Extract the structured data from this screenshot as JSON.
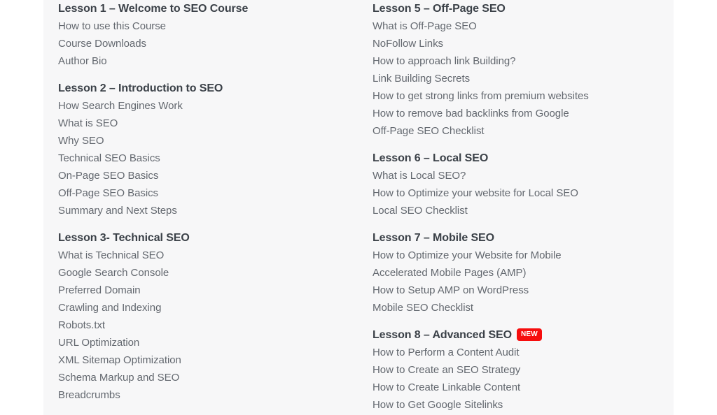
{
  "page": {
    "background_color": "#ffffff",
    "panel_background_color": "#f7f7f8",
    "heading_color": "#3b4148",
    "topic_color": "#63686f",
    "badge_color": "#f60e0e"
  },
  "columns": [
    {
      "id": "left",
      "lessons": [
        {
          "heading": "Lesson 1 – Welcome to SEO Course",
          "badge": null,
          "topics": [
            "How to use this Course",
            "Course Downloads",
            "Author Bio"
          ]
        },
        {
          "heading": "Lesson 2 – Introduction to SEO",
          "badge": null,
          "topics": [
            "How Search Engines Work",
            "What is SEO",
            "Why SEO",
            "Technical SEO Basics",
            "On-Page SEO Basics",
            "Off-Page SEO Basics",
            "Summary and Next Steps"
          ]
        },
        {
          "heading": "Lesson 3- Technical SEO",
          "badge": null,
          "topics": [
            "What is Technical SEO",
            "Google Search Console",
            "Preferred Domain",
            "Crawling and Indexing",
            "Robots.txt",
            "URL Optimization",
            "XML Sitemap Optimization",
            "Schema Markup and SEO",
            "Breadcrumbs"
          ]
        }
      ]
    },
    {
      "id": "right",
      "lessons": [
        {
          "heading": "Lesson 5 – Off-Page SEO",
          "badge": null,
          "topics": [
            "What is Off-Page SEO",
            "NoFollow Links",
            "How to approach link Building?",
            "Link Building Secrets",
            "How to get strong links from premium websites",
            "How to remove bad backlinks from Google",
            "Off-Page SEO Checklist"
          ]
        },
        {
          "heading": "Lesson 6 – Local SEO",
          "badge": null,
          "topics": [
            "What is Local SEO?",
            "How to Optimize your website for Local SEO",
            "Local SEO Checklist"
          ]
        },
        {
          "heading": "Lesson 7 – Mobile SEO",
          "badge": null,
          "topics": [
            "How to Optimize your Website for Mobile",
            "Accelerated Mobile Pages (AMP)",
            "How to Setup AMP on WordPress",
            "Mobile SEO Checklist"
          ]
        },
        {
          "heading": "Lesson 8 – Advanced SEO",
          "badge": "NEW",
          "topics": [
            "How to Perform a Content Audit",
            "How to Create an SEO Strategy",
            "How to Create Linkable Content",
            "How to Get Google Sitelinks"
          ]
        }
      ]
    }
  ]
}
